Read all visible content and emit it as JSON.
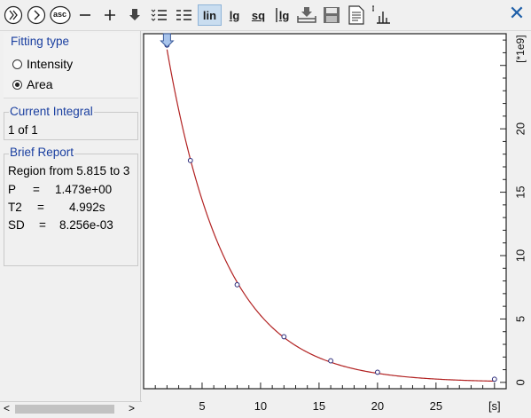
{
  "toolbar": {
    "asc_label": "asc",
    "lin_label": "lin",
    "lg_label": "lg",
    "sq_label": "sq",
    "lglg_label": "lg",
    "icons": [
      "chevrons-down-icon",
      "chevron-right-circle-icon",
      "asc-icon",
      "minus-icon",
      "plus-icon",
      "arrow-down-icon",
      "list-lines-icon",
      "list-lines-2-icon",
      "lin-icon",
      "lg-icon",
      "sq-icon",
      "lg-lg-icon",
      "import-tray-icon",
      "save-disk-icon",
      "document-icon",
      "peak-bars-icon",
      "close-icon"
    ],
    "accent": "#1e5fa8"
  },
  "fitting": {
    "title": "Fitting type",
    "options": [
      {
        "label": "Intensity",
        "selected": false
      },
      {
        "label": "Area",
        "selected": true
      }
    ]
  },
  "integral": {
    "title": "Current Integral",
    "value": "1 of 1"
  },
  "report": {
    "title": "Brief Report",
    "region": "Region from 5.815 to 3",
    "rows": [
      {
        "key": "P",
        "eq": "=",
        "value": "1.473e+00"
      },
      {
        "key": "T2",
        "eq": "=",
        "value": "4.992s"
      },
      {
        "key": "SD",
        "eq": "=",
        "value": "8.256e-03"
      }
    ]
  },
  "scrollbar": {
    "left_arrow": "<",
    "right_arrow": ">"
  },
  "chart_data": {
    "type": "scatter",
    "x_ticks": [
      5,
      10,
      15,
      20,
      25
    ],
    "x_unit": "[s]",
    "y_ticks": [
      0,
      5,
      10,
      15,
      20
    ],
    "y_unit": "[*1e9]",
    "xlim": [
      0,
      31
    ],
    "ylim": [
      -0.5,
      27.5
    ],
    "points": [
      {
        "x": 2,
        "y": 26.6
      },
      {
        "x": 4,
        "y": 17.5
      },
      {
        "x": 8,
        "y": 7.7
      },
      {
        "x": 12,
        "y": 3.6
      },
      {
        "x": 16,
        "y": 1.7
      },
      {
        "x": 20,
        "y": 0.8
      },
      {
        "x": 30,
        "y": 0.25
      }
    ],
    "fit_curve": {
      "amplitude": 39.2,
      "decay": 4.992,
      "color": "#b22222"
    },
    "point_color": "#2a2a7a",
    "marker_x": 2
  }
}
